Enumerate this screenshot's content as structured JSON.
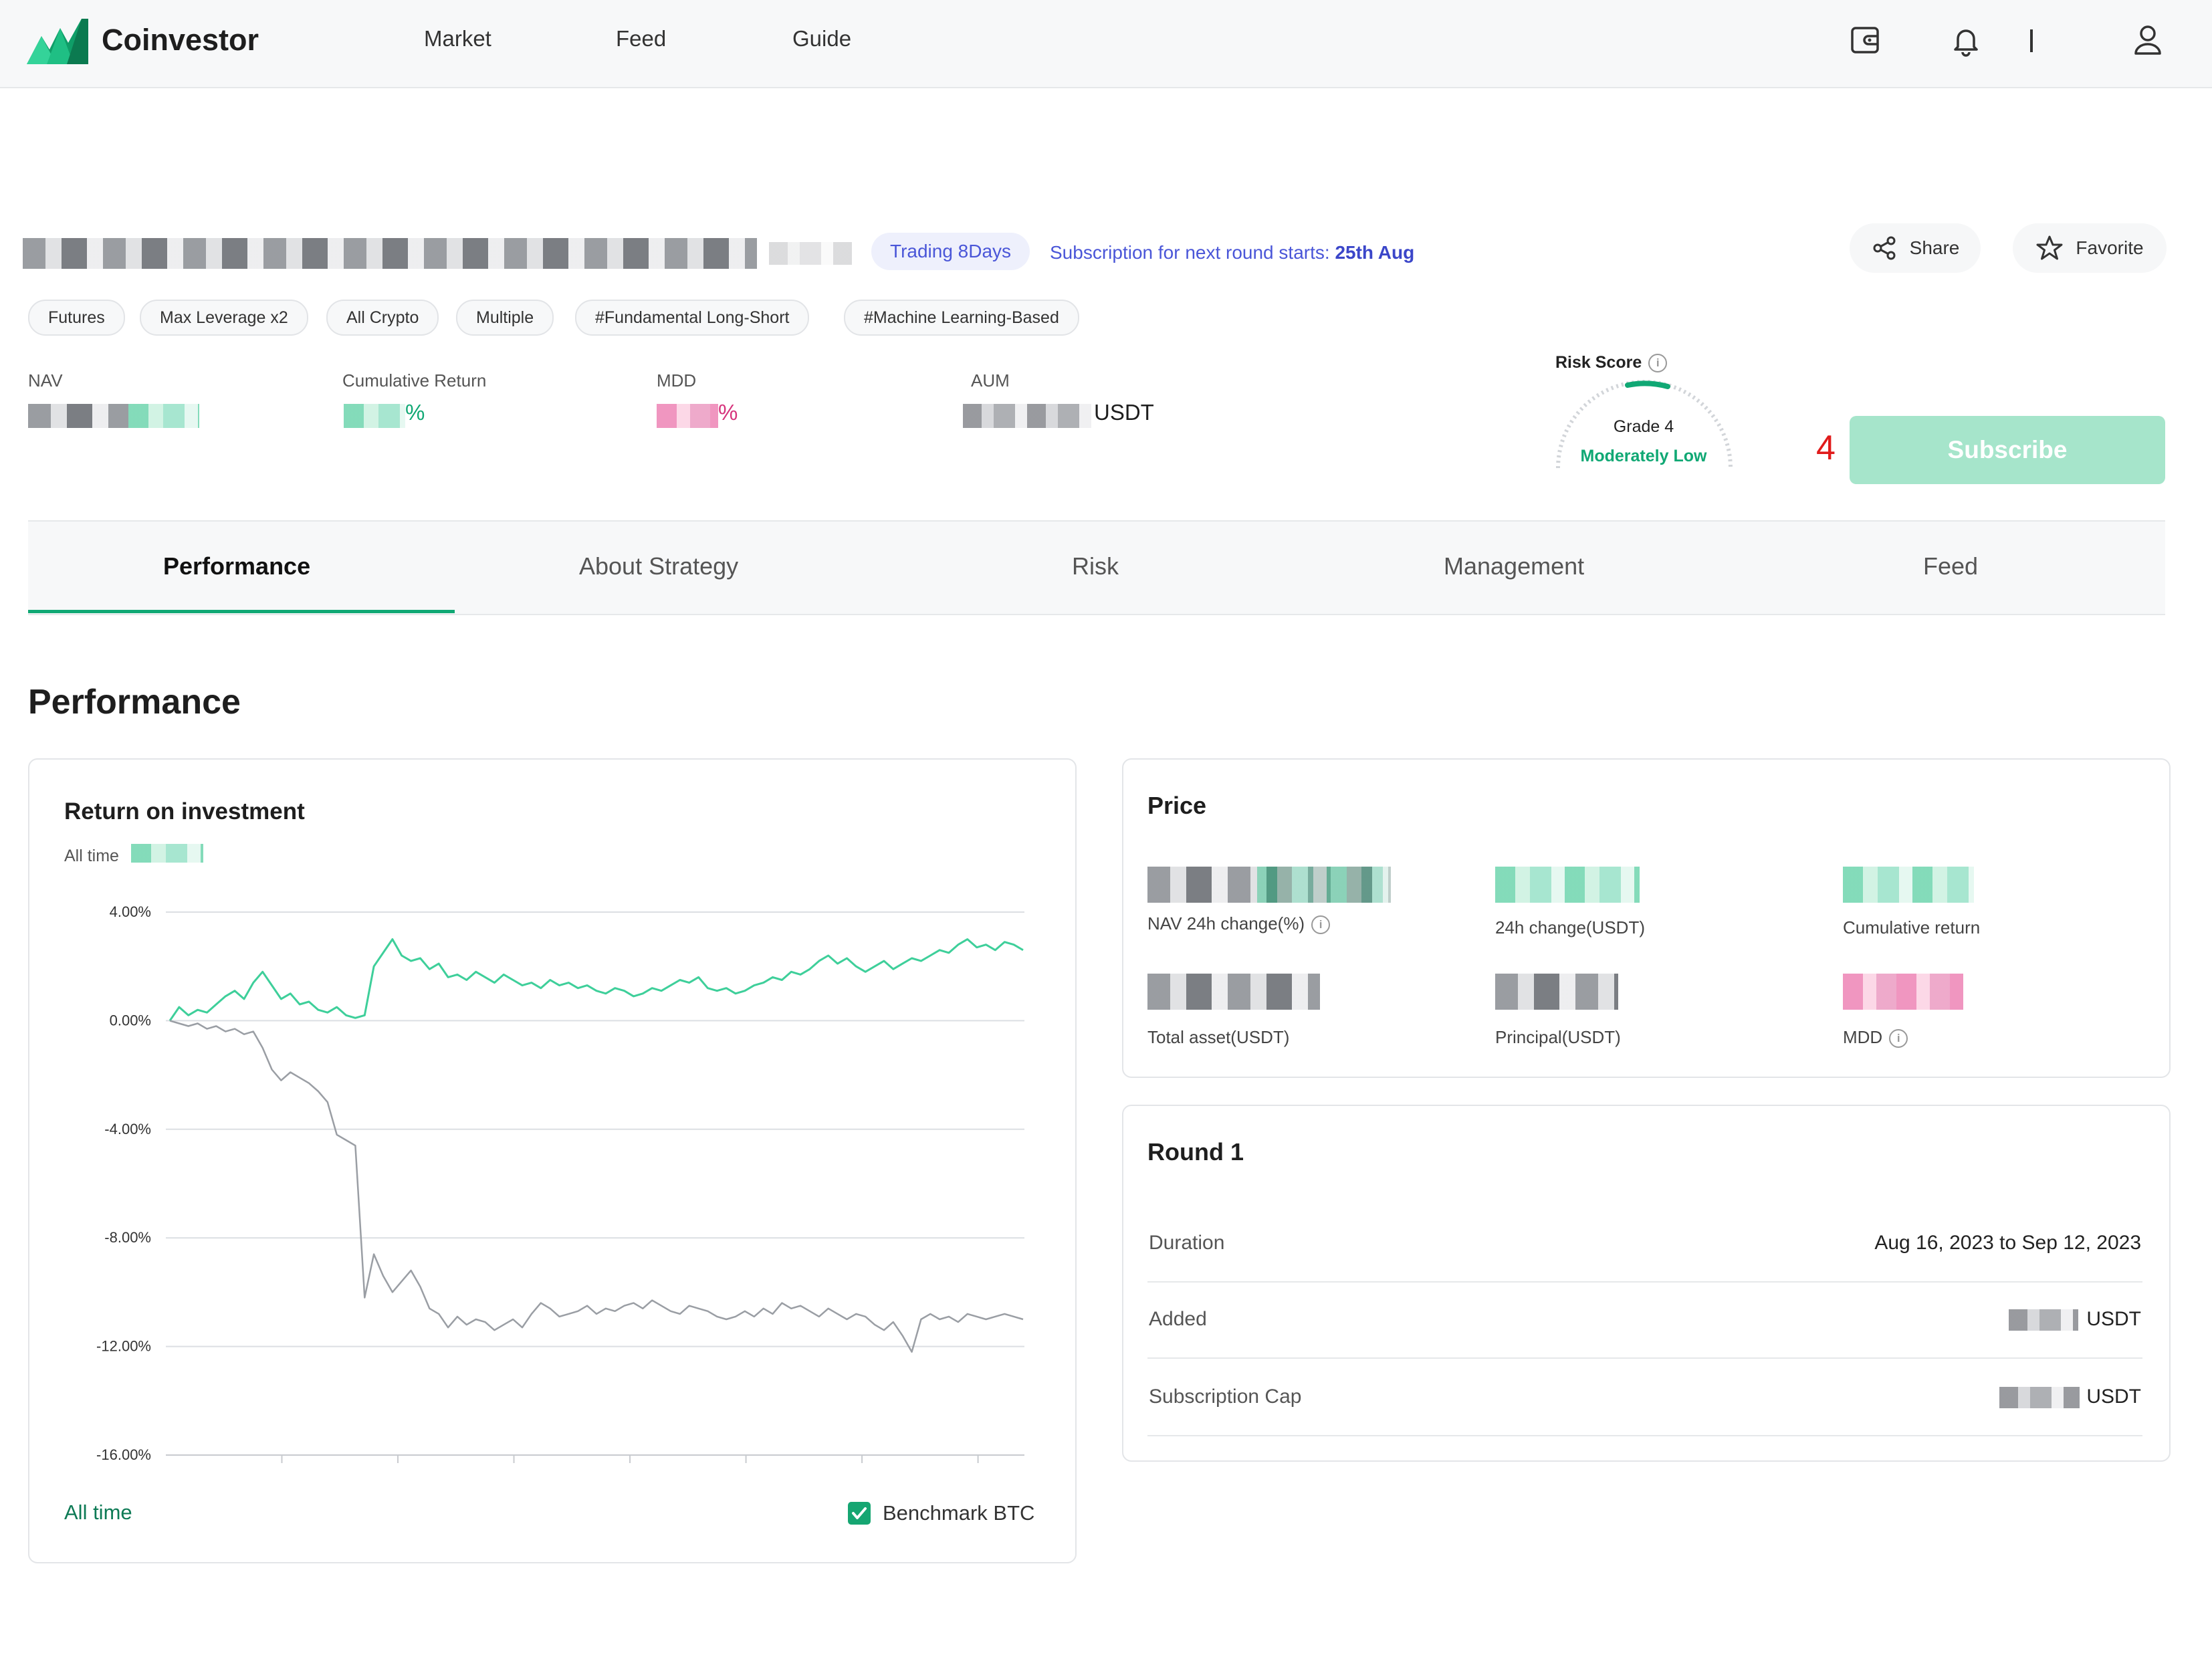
{
  "nav": {
    "brand": "Coinvestor",
    "links": [
      "Market",
      "Feed",
      "Guide"
    ],
    "divider": "|"
  },
  "header": {
    "trading_badge": "Trading 8Days",
    "subscription_note_prefix": "Subscription for next round starts: ",
    "subscription_note_date": "25th Aug",
    "share_label": "Share",
    "favorite_label": "Favorite"
  },
  "tags": [
    "Futures",
    "Max Leverage x2",
    "All Crypto",
    "Multiple",
    "#Fundamental Long-Short",
    "#Machine Learning-Based"
  ],
  "stats": {
    "nav_label": "NAV",
    "cumulative_label": "Cumulative Return",
    "cumulative_suffix": "%",
    "mdd_label": "MDD",
    "mdd_suffix": "%",
    "aum_label": "AUM",
    "aum_unit": "USDT"
  },
  "risk": {
    "label": "Risk Score",
    "grade": "Grade 4",
    "description": "Moderately Low",
    "accent": "#10a874"
  },
  "annotation": "4",
  "subscribe_label": "Subscribe",
  "tabs": [
    "Performance",
    "About Strategy",
    "Risk",
    "Management",
    "Feed"
  ],
  "section_title": "Performance",
  "roi": {
    "title": "Return on investment",
    "all_time_label": "All time",
    "footer_all_time": "All time",
    "benchmark_label": "Benchmark BTC",
    "benchmark_checked": true
  },
  "price": {
    "title": "Price",
    "labels": [
      "NAV 24h change(%)",
      "24h change(USDT)",
      "Cumulative return",
      "Total asset(USDT)",
      "Principal(USDT)",
      "MDD"
    ]
  },
  "round": {
    "title": "Round 1",
    "rows": [
      {
        "label": "Duration",
        "value": "Aug 16, 2023 to Sep 12, 2023"
      },
      {
        "label": "Added",
        "value": "USDT"
      },
      {
        "label": "Subscription Cap",
        "value": "USDT"
      }
    ]
  },
  "colors": {
    "strategy_line": "#3ecf9a",
    "benchmark_line": "#9a9ea4",
    "brand_green": "#16a672"
  },
  "chart_data": {
    "type": "line",
    "y_tick_labels": [
      "4.00%",
      "0.00%",
      "-4.00%",
      "-8.00%",
      "-12.00%",
      "-16.00%"
    ],
    "ylim": [
      -16,
      4
    ],
    "grid": true,
    "series": [
      {
        "values": [
          0.0,
          0.5,
          0.2,
          0.4,
          0.3,
          0.6,
          0.9,
          1.1,
          0.8,
          1.4,
          1.8,
          1.3,
          0.8,
          1.0,
          0.6,
          0.7,
          0.4,
          0.3,
          0.5,
          0.2,
          0.1,
          0.2,
          2.0,
          2.5,
          3.0,
          2.4,
          2.2,
          2.3,
          1.9,
          2.1,
          1.6,
          1.7,
          1.5,
          1.8,
          1.6,
          1.4,
          1.7,
          1.5,
          1.3,
          1.4,
          1.2,
          1.5,
          1.3,
          1.4,
          1.2,
          1.3,
          1.1,
          1.0,
          1.2,
          1.1,
          0.9,
          1.0,
          1.2,
          1.1,
          1.3,
          1.5,
          1.4,
          1.6,
          1.2,
          1.1,
          1.2,
          1.0,
          1.1,
          1.3,
          1.4,
          1.6,
          1.5,
          1.8,
          1.7,
          1.9,
          2.2,
          2.4,
          2.1,
          2.3,
          2.0,
          1.8,
          2.0,
          2.2,
          1.9,
          2.1,
          2.3,
          2.2,
          2.4,
          2.6,
          2.5,
          2.8,
          3.0,
          2.7,
          2.8,
          2.6,
          2.9,
          2.8,
          2.6
        ]
      },
      {
        "values": [
          0.0,
          -0.1,
          -0.2,
          -0.1,
          -0.3,
          -0.2,
          -0.4,
          -0.3,
          -0.5,
          -0.4,
          -1.0,
          -1.8,
          -2.2,
          -1.9,
          -2.1,
          -2.3,
          -2.6,
          -3.0,
          -4.2,
          -4.4,
          -4.6,
          -10.2,
          -8.6,
          -9.4,
          -10.0,
          -9.6,
          -9.2,
          -9.8,
          -10.6,
          -10.8,
          -11.3,
          -10.9,
          -11.2,
          -11.0,
          -11.1,
          -11.4,
          -11.2,
          -11.0,
          -11.3,
          -10.8,
          -10.4,
          -10.6,
          -10.9,
          -10.8,
          -10.7,
          -10.5,
          -10.8,
          -10.6,
          -10.7,
          -10.5,
          -10.4,
          -10.6,
          -10.3,
          -10.5,
          -10.7,
          -10.8,
          -10.5,
          -10.6,
          -10.7,
          -10.9,
          -11.0,
          -10.9,
          -10.7,
          -10.9,
          -10.6,
          -10.8,
          -10.4,
          -10.6,
          -10.5,
          -10.7,
          -10.9,
          -10.6,
          -10.8,
          -11.0,
          -10.8,
          -10.9,
          -11.2,
          -11.4,
          -11.1,
          -11.6,
          -12.2,
          -11.0,
          -10.8,
          -11.0,
          -10.9,
          -11.1,
          -10.8,
          -10.9,
          -11.0,
          -10.9,
          -10.8,
          -10.9,
          -11.0
        ]
      }
    ]
  }
}
